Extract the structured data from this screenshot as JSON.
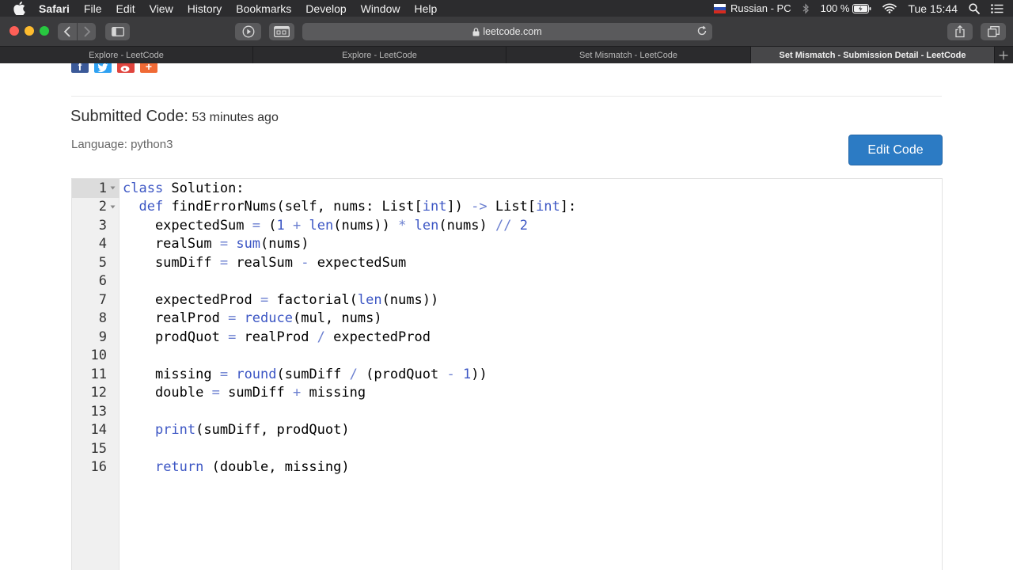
{
  "menubar": {
    "app": "Safari",
    "items": [
      "File",
      "Edit",
      "View",
      "History",
      "Bookmarks",
      "Develop",
      "Window",
      "Help"
    ],
    "input_source": "Russian - PC",
    "battery": "100 %",
    "clock": "Tue 15:44"
  },
  "toolbar": {
    "address": "leetcode.com"
  },
  "tabs": [
    {
      "label": "Explore - LeetCode"
    },
    {
      "label": "Explore - LeetCode"
    },
    {
      "label": "Set Mismatch - LeetCode"
    },
    {
      "label": "Set Mismatch - Submission Detail - LeetCode"
    }
  ],
  "page": {
    "submitted_label": "Submitted Code:",
    "submitted_time": "53 minutes ago",
    "language": "Language: python3",
    "edit_button": "Edit Code"
  },
  "code_lines": [
    {
      "n": "1",
      "fold": true,
      "tokens": [
        [
          "kw",
          "class"
        ],
        [
          "t",
          " Solution:"
        ]
      ]
    },
    {
      "n": "2",
      "fold": true,
      "tokens": [
        [
          "t",
          "  "
        ],
        [
          "kw",
          "def"
        ],
        [
          "t",
          " findErrorNums(self, nums: List["
        ],
        [
          "bi",
          "int"
        ],
        [
          "t",
          "]) "
        ],
        [
          "op",
          "->"
        ],
        [
          "t",
          " List["
        ],
        [
          "bi",
          "int"
        ],
        [
          "t",
          "]:"
        ]
      ]
    },
    {
      "n": "3",
      "fold": false,
      "tokens": [
        [
          "t",
          "    expectedSum "
        ],
        [
          "op",
          "="
        ],
        [
          "t",
          " ("
        ],
        [
          "num",
          "1"
        ],
        [
          "t",
          " "
        ],
        [
          "op",
          "+"
        ],
        [
          "t",
          " "
        ],
        [
          "bi",
          "len"
        ],
        [
          "t",
          "(nums)) "
        ],
        [
          "op",
          "*"
        ],
        [
          "t",
          " "
        ],
        [
          "bi",
          "len"
        ],
        [
          "t",
          "(nums) "
        ],
        [
          "op",
          "//"
        ],
        [
          "t",
          " "
        ],
        [
          "num",
          "2"
        ]
      ]
    },
    {
      "n": "4",
      "fold": false,
      "tokens": [
        [
          "t",
          "    realSum "
        ],
        [
          "op",
          "="
        ],
        [
          "t",
          " "
        ],
        [
          "bi",
          "sum"
        ],
        [
          "t",
          "(nums)"
        ]
      ]
    },
    {
      "n": "5",
      "fold": false,
      "tokens": [
        [
          "t",
          "    sumDiff "
        ],
        [
          "op",
          "="
        ],
        [
          "t",
          " realSum "
        ],
        [
          "op",
          "-"
        ],
        [
          "t",
          " expectedSum"
        ]
      ]
    },
    {
      "n": "6",
      "fold": false,
      "tokens": [
        [
          "t",
          ""
        ]
      ]
    },
    {
      "n": "7",
      "fold": false,
      "tokens": [
        [
          "t",
          "    expectedProd "
        ],
        [
          "op",
          "="
        ],
        [
          "t",
          " factorial("
        ],
        [
          "bi",
          "len"
        ],
        [
          "t",
          "(nums))"
        ]
      ]
    },
    {
      "n": "8",
      "fold": false,
      "tokens": [
        [
          "t",
          "    realProd "
        ],
        [
          "op",
          "="
        ],
        [
          "t",
          " "
        ],
        [
          "bi",
          "reduce"
        ],
        [
          "t",
          "(mul, nums)"
        ]
      ]
    },
    {
      "n": "9",
      "fold": false,
      "tokens": [
        [
          "t",
          "    prodQuot "
        ],
        [
          "op",
          "="
        ],
        [
          "t",
          " realProd "
        ],
        [
          "op",
          "/"
        ],
        [
          "t",
          " expectedProd"
        ]
      ]
    },
    {
      "n": "10",
      "fold": false,
      "tokens": [
        [
          "t",
          ""
        ]
      ]
    },
    {
      "n": "11",
      "fold": false,
      "tokens": [
        [
          "t",
          "    missing "
        ],
        [
          "op",
          "="
        ],
        [
          "t",
          " "
        ],
        [
          "bi",
          "round"
        ],
        [
          "t",
          "(sumDiff "
        ],
        [
          "op",
          "/"
        ],
        [
          "t",
          " (prodQuot "
        ],
        [
          "op",
          "-"
        ],
        [
          "t",
          " "
        ],
        [
          "num",
          "1"
        ],
        [
          "t",
          "))"
        ]
      ]
    },
    {
      "n": "12",
      "fold": false,
      "tokens": [
        [
          "t",
          "    double "
        ],
        [
          "op",
          "="
        ],
        [
          "t",
          " sumDiff "
        ],
        [
          "op",
          "+"
        ],
        [
          "t",
          " missing"
        ]
      ]
    },
    {
      "n": "13",
      "fold": false,
      "tokens": [
        [
          "t",
          ""
        ]
      ]
    },
    {
      "n": "14",
      "fold": false,
      "tokens": [
        [
          "t",
          "    "
        ],
        [
          "bi",
          "print"
        ],
        [
          "t",
          "(sumDiff, prodQuot)"
        ]
      ]
    },
    {
      "n": "15",
      "fold": false,
      "tokens": [
        [
          "t",
          ""
        ]
      ]
    },
    {
      "n": "16",
      "fold": false,
      "tokens": [
        [
          "t",
          "    "
        ],
        [
          "kw",
          "return"
        ],
        [
          "t",
          " (double, missing)"
        ]
      ]
    }
  ],
  "colors": {
    "menubar_bg": "#2c2c2e",
    "toolbar_bg": "#3b3b3d",
    "button_blue": "#2c7bc4",
    "keyword": "#3c56c4",
    "operator": "#6b7fd0"
  }
}
